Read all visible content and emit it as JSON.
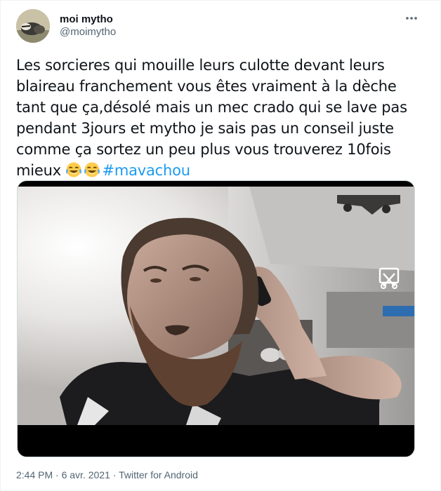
{
  "author": {
    "display_name": "moi mytho",
    "handle": "@moimytho"
  },
  "tweet": {
    "lines": [
      "Les sorcieres qui mouille leurs culotte devant leurs",
      "blaireau franchement vous êtes vraiment à la dèche",
      "tant que ça,désolé mais un mec crado qui se lave pas",
      "pendant 3jours et mytho je sais pas un conseil juste",
      "comme ça sortez un peu plus vous trouverez 10fois"
    ],
    "last_line_text": "mieux ",
    "emojis": [
      "face-with-tears-of-joy",
      "face-with-tears-of-joy"
    ],
    "hashtag": "#mavachou"
  },
  "meta": {
    "time": "2:44 PM",
    "separator1": " · ",
    "date": "6 avr. 2021",
    "separator2": " · ",
    "source": "Twitter for Android"
  },
  "colors": {
    "hashtag": "#1d9bf0",
    "secondary_text": "#536471",
    "primary_text": "#0f1419"
  },
  "icons": {
    "more": "more-horizontal-icon",
    "pip": "picture-in-picture-icon"
  }
}
